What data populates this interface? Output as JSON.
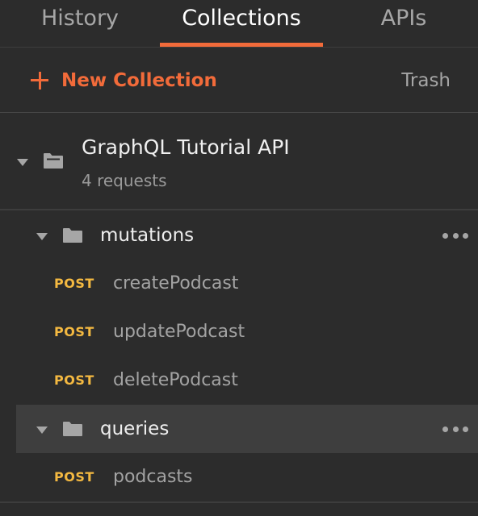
{
  "tabs": [
    {
      "label": "History",
      "active": false
    },
    {
      "label": "Collections",
      "active": true
    },
    {
      "label": "APIs",
      "active": false
    }
  ],
  "actions": {
    "new_collection_label": "New Collection",
    "trash_label": "Trash"
  },
  "collection": {
    "name": "GraphQL Tutorial API",
    "meta": "4 requests",
    "icon": "collection-folder-icon",
    "expanded": true,
    "folders": [
      {
        "name": "mutations",
        "expanded": true,
        "selected": false,
        "requests": [
          {
            "method": "POST",
            "name": "createPodcast"
          },
          {
            "method": "POST",
            "name": "updatePodcast"
          },
          {
            "method": "POST",
            "name": "deletePodcast"
          }
        ]
      },
      {
        "name": "queries",
        "expanded": true,
        "selected": true,
        "requests": [
          {
            "method": "POST",
            "name": "podcasts"
          }
        ]
      }
    ]
  },
  "colors": {
    "background": "#2c2c2c",
    "accent": "#f26b3a",
    "method_post": "#f4b941",
    "selected_row": "#3e3e3e"
  }
}
